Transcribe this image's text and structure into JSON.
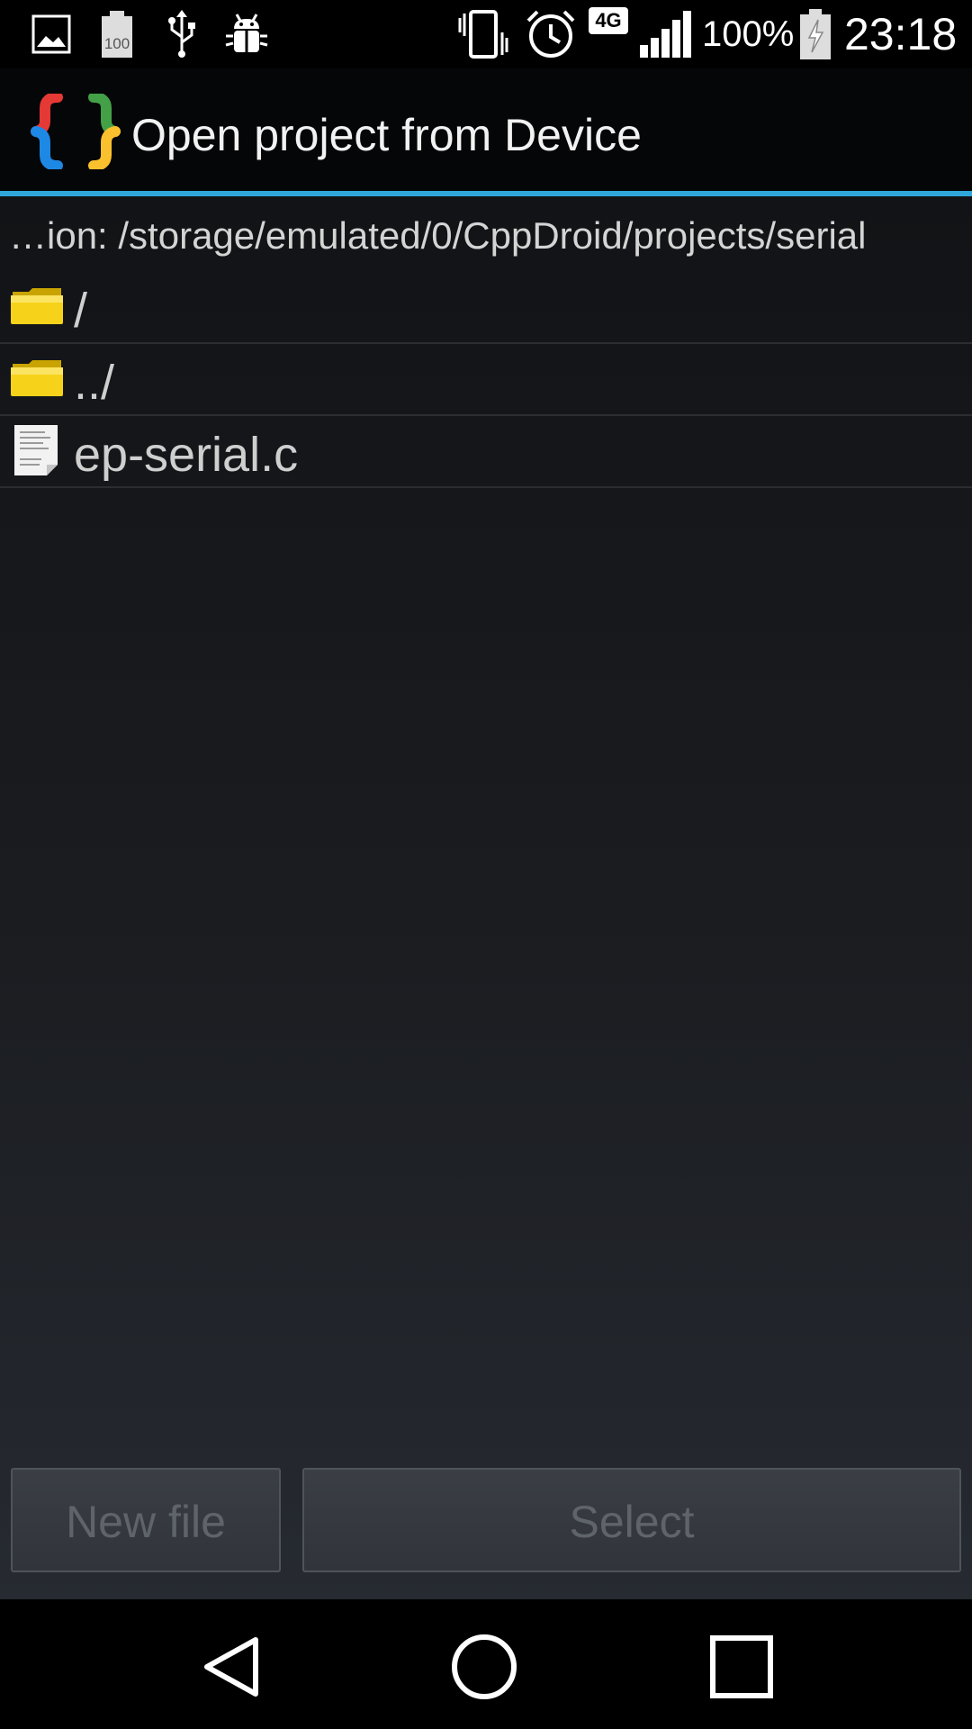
{
  "status_bar": {
    "battery_percent": "100%",
    "time": "23:18",
    "network_type": "4G",
    "notification_icons": [
      "image-icon",
      "battery-100-icon",
      "usb-icon",
      "android-debug-icon"
    ],
    "system_icons": [
      "vibrate-icon",
      "alarm-icon",
      "network-4g-icon",
      "signal-icon",
      "battery-charging-icon"
    ]
  },
  "title_bar": {
    "title": "Open project from Device",
    "logo_colors": [
      "#e53935",
      "#1e88e5",
      "#43a047",
      "#fbc02d"
    ],
    "accent_color": "#2fa6d9"
  },
  "file_browser": {
    "path_label": "…ion: /storage/emulated/0/CppDroid/projects/serial",
    "entries": [
      {
        "name": "/",
        "icon": "folder-icon"
      },
      {
        "name": "../",
        "icon": "folder-icon"
      },
      {
        "name": "ep-serial.c",
        "icon": "file-icon"
      }
    ]
  },
  "buttons": {
    "new_file": "New file",
    "select": "Select"
  },
  "nav_bar": {
    "icons": [
      "back-icon",
      "home-icon",
      "recents-icon"
    ]
  }
}
